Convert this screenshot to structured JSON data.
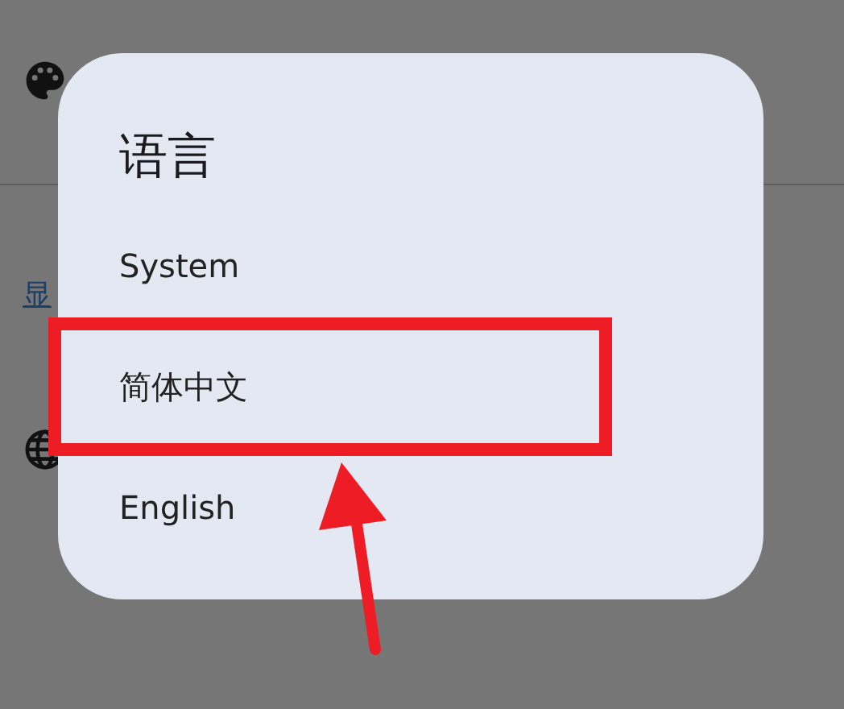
{
  "background": {
    "link_text": "显"
  },
  "dialog": {
    "title": "语言",
    "options": [
      {
        "label": "System"
      },
      {
        "label": "简体中文"
      },
      {
        "label": "English"
      }
    ]
  }
}
